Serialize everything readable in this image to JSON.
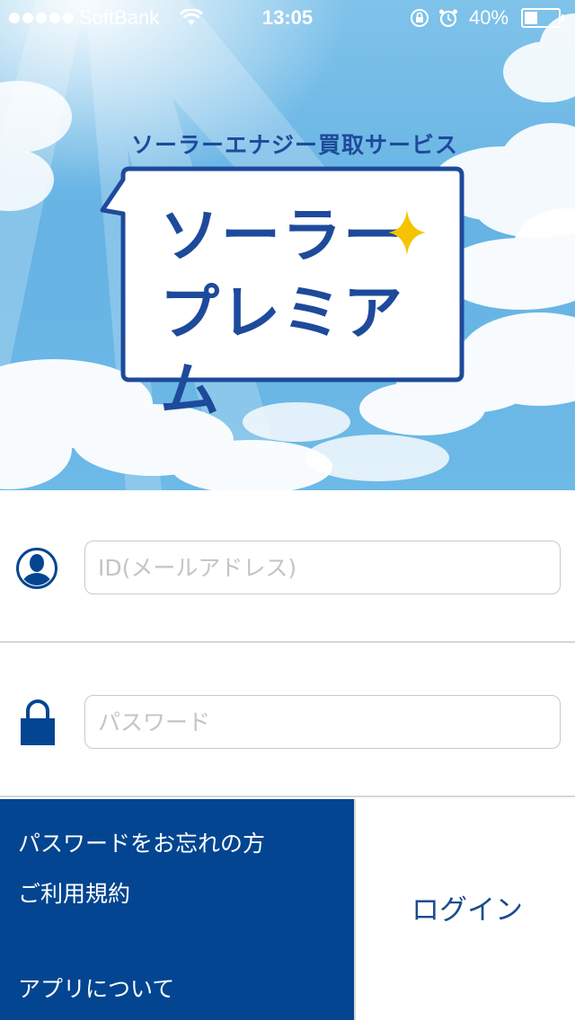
{
  "status_bar": {
    "carrier": "SoftBank",
    "time": "13:05",
    "battery": "40%",
    "battery_level": 0.4,
    "icons": [
      "signal-dots",
      "wifi-icon",
      "rotation-lock-icon",
      "alarm-icon",
      "battery-icon"
    ]
  },
  "logo": {
    "subtitle": "ソーラーエナジー買取サービス",
    "title_line1": "ソーラー",
    "title_line2": "プレミアム"
  },
  "login_form": {
    "id_field": {
      "placeholder": "ID(メールアドレス)",
      "value": "",
      "icon": "user-icon"
    },
    "password_field": {
      "placeholder": "パスワード",
      "value": "",
      "icon": "lock-icon"
    }
  },
  "links": {
    "forgot_password": "パスワードをお忘れの方",
    "terms": "ご利用規約",
    "about": "アプリについて"
  },
  "login_button": {
    "label": "ログイン"
  },
  "colors": {
    "brand_blue": "#034591",
    "logo_blue": "#1e4a9b",
    "sparkle": "#f5c400",
    "sky": "#6db9e7"
  }
}
